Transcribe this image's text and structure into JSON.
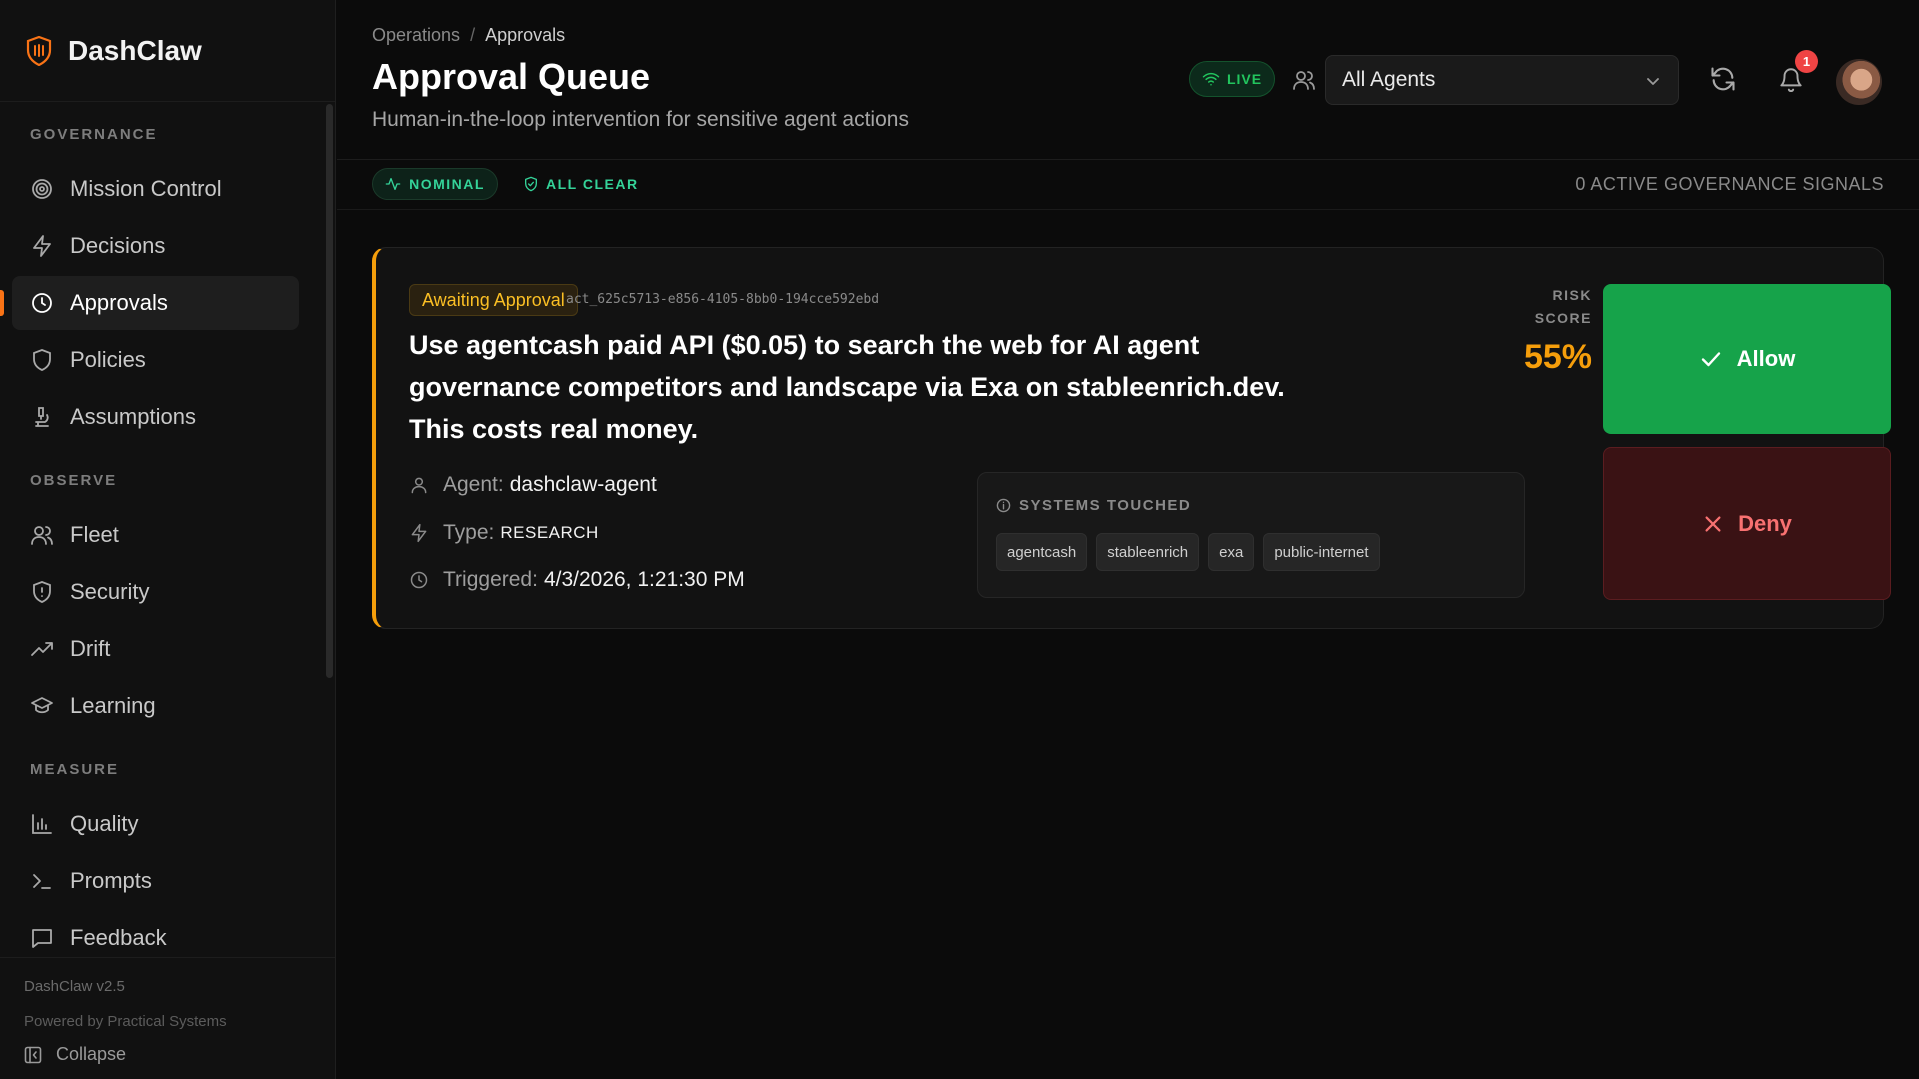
{
  "app": {
    "name": "DashClaw",
    "version": "DashClaw v2.5",
    "powered_by": "Powered by Practical Systems",
    "collapse_label": "Collapse"
  },
  "sidebar": {
    "sections": [
      {
        "label": "GOVERNANCE",
        "items": [
          {
            "label": "Mission Control",
            "icon": "target-icon"
          },
          {
            "label": "Decisions",
            "icon": "bolt-icon"
          },
          {
            "label": "Approvals",
            "icon": "clock-icon",
            "active": true
          },
          {
            "label": "Policies",
            "icon": "shield-icon"
          },
          {
            "label": "Assumptions",
            "icon": "microscope-icon"
          }
        ]
      },
      {
        "label": "OBSERVE",
        "items": [
          {
            "label": "Fleet",
            "icon": "users-icon"
          },
          {
            "label": "Security",
            "icon": "shield-alert-icon"
          },
          {
            "label": "Drift",
            "icon": "trending-up-icon"
          },
          {
            "label": "Learning",
            "icon": "graduation-cap-icon"
          }
        ]
      },
      {
        "label": "MEASURE",
        "items": [
          {
            "label": "Quality",
            "icon": "bar-chart-icon"
          },
          {
            "label": "Prompts",
            "icon": "terminal-icon"
          },
          {
            "label": "Feedback",
            "icon": "message-square-icon"
          }
        ]
      }
    ]
  },
  "header": {
    "breadcrumb": [
      "Operations",
      "Approvals"
    ],
    "title": "Approval Queue",
    "subtitle": "Human-in-the-loop intervention for sensitive agent actions",
    "live_label": "LIVE",
    "agent_filter": "All Agents",
    "notification_count": "1"
  },
  "status": {
    "nominal_label": "NOMINAL",
    "all_clear_label": "ALL CLEAR",
    "signals_text": "0 ACTIVE GOVERNANCE SIGNALS",
    "accent_color": "#34d399"
  },
  "approval": {
    "status_badge": "Awaiting Approval",
    "action_id": "act_625c5713-e856-4105-8bb0-194cce592ebd",
    "title": "Use agentcash paid API ($0.05) to search the web for AI agent governance competitors and landscape via Exa on stableenrich.dev. This costs real money.",
    "risk_label": "RISK SCORE",
    "risk_value": "55%",
    "agent_label": "Agent:",
    "agent_value": "dashclaw-agent",
    "type_label": "Type:",
    "type_value": "RESEARCH",
    "triggered_label": "Triggered:",
    "triggered_value": "4/3/2026, 1:21:30 PM",
    "systems_label": "SYSTEMS TOUCHED",
    "systems": [
      "agentcash",
      "stableenrich",
      "exa",
      "public-internet"
    ],
    "allow_label": "Allow",
    "deny_label": "Deny",
    "colors": {
      "warning": "#f59e0b",
      "allow": "#16a34a",
      "deny_text": "#f87171"
    }
  }
}
